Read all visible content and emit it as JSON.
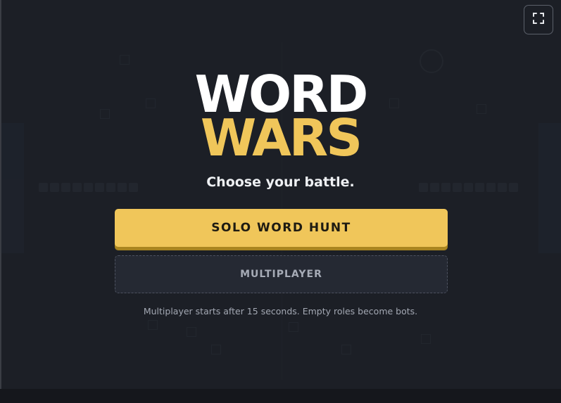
{
  "logo": {
    "line1": "WORD",
    "line2": "WARS"
  },
  "subtitle": "Choose your battle.",
  "buttons": {
    "solo_label": "SOLO WORD HUNT",
    "multiplayer_label": "MULTIPLAYER"
  },
  "note": "Multiplayer starts after 15 seconds. Empty roles become bots.",
  "icons": {
    "fullscreen": "fullscreen-icon"
  },
  "colors": {
    "background": "#1c1f26",
    "accent": "#f0c65a",
    "title_white": "#ffffff",
    "secondary_button": "#252933"
  }
}
